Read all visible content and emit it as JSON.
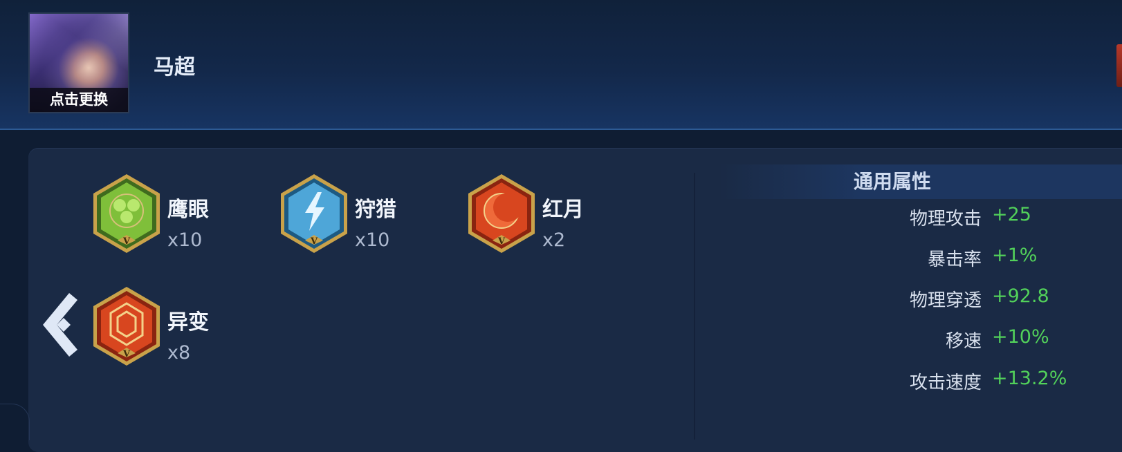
{
  "header": {
    "hero_name": "马超",
    "avatar_caption": "点击更换"
  },
  "runes": [
    {
      "name": "鹰眼",
      "count": "x10",
      "icon": "hawkeye-rune-icon",
      "color": "#7fbf3a"
    },
    {
      "name": "狩猎",
      "count": "x10",
      "icon": "hunt-rune-icon",
      "color": "#4ea6d8"
    },
    {
      "name": "红月",
      "count": "x2",
      "icon": "red-moon-rune-icon",
      "color": "#d8461f"
    },
    {
      "name": "异变",
      "count": "x8",
      "icon": "mutation-rune-icon",
      "color": "#d8461f"
    }
  ],
  "attributes": {
    "title": "通用属性",
    "items": [
      {
        "label": "物理攻击",
        "value": "+25"
      },
      {
        "label": "暴击率",
        "value": "+1%"
      },
      {
        "label": "物理穿透",
        "value": "+92.8"
      },
      {
        "label": "移速",
        "value": "+10%"
      },
      {
        "label": "攻击速度",
        "value": "+13.2%"
      }
    ]
  },
  "colors": {
    "positive_value": "#52d15a",
    "panel": "#1a2a45",
    "header": "#13284a"
  }
}
